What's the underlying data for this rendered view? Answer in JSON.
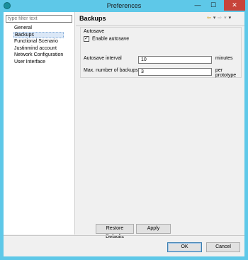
{
  "window": {
    "title": "Preferences",
    "minimize_glyph": "—",
    "maximize_glyph": "☐",
    "close_glyph": "✕"
  },
  "sidebar": {
    "filter_placeholder": "type filter text",
    "items": [
      {
        "label": "General",
        "selected": false
      },
      {
        "label": "Backups",
        "selected": true
      },
      {
        "label": "Functional Scenario",
        "selected": false
      },
      {
        "label": "Justinmind account",
        "selected": false
      },
      {
        "label": "Network Configuration",
        "selected": false
      },
      {
        "label": "User Interface",
        "selected": false
      }
    ]
  },
  "page": {
    "title": "Backups",
    "nav": {
      "back_icon": "arrow-left-icon",
      "forward_icon": "arrow-right-icon",
      "menu_icon": "chevron-down-icon",
      "back_glyph": "⇦",
      "dropdown_glyph": "▾",
      "forward_glyph": "⇨",
      "menu_glyph": "▾"
    }
  },
  "autosave": {
    "group_title": "Autosave",
    "enable_label": "Enable autosave",
    "enable_checked": true,
    "check_glyph": "✓",
    "interval_label": "Autosave interval",
    "interval_value": "10",
    "interval_unit": "minutes",
    "max_backups_label": "Max. number of backups",
    "max_backups_value": "3",
    "max_backups_unit": "per prototype"
  },
  "buttons": {
    "restore_defaults": "Restore Defaults",
    "apply": "Apply",
    "ok": "OK",
    "cancel": "Cancel"
  },
  "colors": {
    "window_frame": "#5ec8e8",
    "close_button": "#c7443a",
    "back_arrow": "#d4a017"
  }
}
